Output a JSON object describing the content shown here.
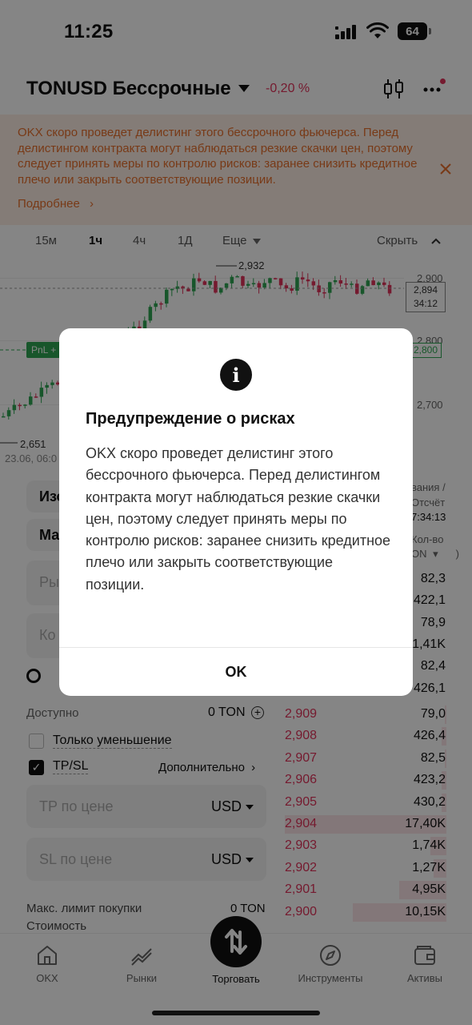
{
  "status_bar": {
    "time": "11:25",
    "battery": "64"
  },
  "header": {
    "title": "TONUSD Бессрочные",
    "change": "-0,20 %"
  },
  "banner": {
    "text": "OKX скоро проведет делистинг этого бессрочного фьючерса. Перед делистингом контракта могут наблюдаться резкие скачки цен, поэтому следует принять меры по контролю рисков: заранее снизить кредитное плечо или закрыть соответствующие позиции.",
    "more": "Подробнее"
  },
  "timeframes": [
    "15м",
    "1ч",
    "4ч",
    "1Д",
    "Еще"
  ],
  "hide_label": "Скрыть",
  "chart": {
    "y_labels": [
      "2,900",
      "2,800",
      "2,700"
    ],
    "high_label": "2,932",
    "low_label": "2,651",
    "date_label": "23.06, 06:0",
    "current_price": "2,894",
    "countdown": "34:12",
    "pnl_label": "PnL +",
    "pnl_price": "2,800"
  },
  "form": {
    "field1": "Изо",
    "field2": "Ма",
    "field3_ph": "Ры",
    "field4_ph": "Ко",
    "available_label": "Доступно",
    "available_value": "0 TON",
    "reduce_only": "Только уменьшение",
    "tpsl": "TP/SL",
    "advanced": "Дополнительно",
    "tp_placeholder": "TP по цене",
    "sl_placeholder": "SL по цене",
    "currency": "USD",
    "limit_label": "Макс. лимит покупки",
    "limit_value": "0 TON",
    "cost_label": "Стоимость"
  },
  "orderbook": {
    "head1": "вания /",
    "head2": "Отсчёт",
    "head3": "7:34:13",
    "head4": "Кол-во",
    "head5": "ON",
    "top_qty": [
      "82,3",
      "422,1",
      "78,9",
      "1,41K",
      "82,4",
      "426,1"
    ],
    "rows": [
      {
        "price": "2,909",
        "qty": "79,0",
        "fill": 0.01
      },
      {
        "price": "2,908",
        "qty": "426,4",
        "fill": 0.03
      },
      {
        "price": "2,907",
        "qty": "82,5",
        "fill": 0.01
      },
      {
        "price": "2,906",
        "qty": "423,2",
        "fill": 0.03
      },
      {
        "price": "2,905",
        "qty": "430,2",
        "fill": 0.03
      },
      {
        "price": "2,904",
        "qty": "17,40K",
        "fill": 1.0
      },
      {
        "price": "2,903",
        "qty": "1,74K",
        "fill": 0.1
      },
      {
        "price": "2,902",
        "qty": "1,27K",
        "fill": 0.08
      },
      {
        "price": "2,901",
        "qty": "4,95K",
        "fill": 0.29
      },
      {
        "price": "2,900",
        "qty": "10,15K",
        "fill": 0.58
      }
    ]
  },
  "nav": {
    "okx": "OKX",
    "markets": "Рынки",
    "trade": "Торговать",
    "tools": "Инструменты",
    "assets": "Активы"
  },
  "modal": {
    "title": "Предупреждение о рисках",
    "body": "OKX скоро проведет делистинг этого бессрочного фьючерса. Перед делистингом контракта могут наблюдаться резкие скачки цен, поэтому следует принять меры по контролю рисков: заранее снизить кредитное плечо или закрыть соответствующие позиции.",
    "ok": "OK"
  },
  "colors": {
    "up": "#2ea653",
    "down": "#e1335a",
    "warning": "#e76f2c"
  }
}
